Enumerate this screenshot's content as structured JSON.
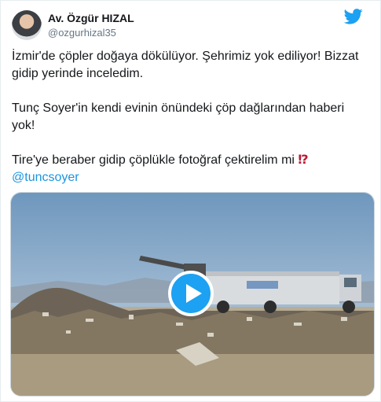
{
  "author": {
    "name": "Av. Özgür HIZAL",
    "handle": "@ozgurhizal35"
  },
  "tweet": {
    "paragraph_1": "İzmir'de çöpler doğaya dökülüyor. Şehrimiz yok ediliyor! Bizzat gidip yerinde inceledim.",
    "paragraph_2": "Tunç Soyer'in kendi evinin önündeki çöp dağlarından haberi yok!",
    "paragraph_3": "Tire'ye beraber gidip çöplükle fotoğraf çektirelim mi",
    "emoji": "⁉",
    "mention": "@tuncsoyer"
  },
  "media": {
    "type": "video",
    "icon": "play-icon"
  },
  "colors": {
    "twitter_blue": "#1da1f2",
    "link_blue": "#1b95e0",
    "handle_gray": "#657786"
  },
  "icons": {
    "brand": "twitter-bird-icon"
  }
}
